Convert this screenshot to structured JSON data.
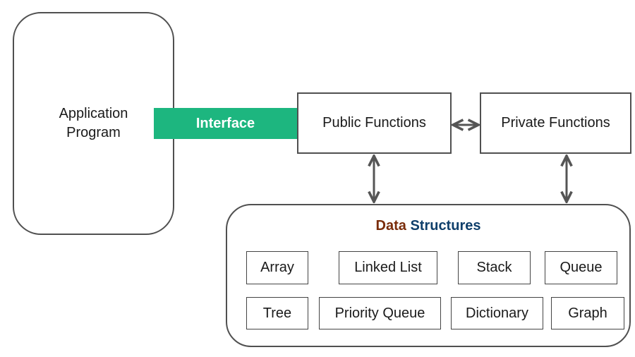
{
  "application_program": {
    "line1": "Application",
    "line2": "Program"
  },
  "interface": {
    "label": "Interface",
    "color": "#1db67f"
  },
  "public_functions": {
    "label": "Public Functions"
  },
  "private_functions": {
    "label": "Private Functions"
  },
  "data_structures": {
    "title_part1": "Data",
    "title_part2": "Structures",
    "title_part1_color": "#7a2c0a",
    "title_part2_color": "#0f3f6b",
    "items": [
      "Array",
      "Linked List",
      "Stack",
      "Queue",
      "Tree",
      "Priority Queue",
      "Dictionary",
      "Graph"
    ]
  },
  "connections": [
    {
      "from": "Public Functions",
      "to": "Private Functions",
      "type": "bidirectional"
    },
    {
      "from": "Public Functions",
      "to": "Data Structures",
      "type": "bidirectional"
    },
    {
      "from": "Private Functions",
      "to": "Data Structures",
      "type": "bidirectional"
    },
    {
      "from": "Application Program",
      "to": "Public Functions",
      "via": "Interface"
    }
  ]
}
